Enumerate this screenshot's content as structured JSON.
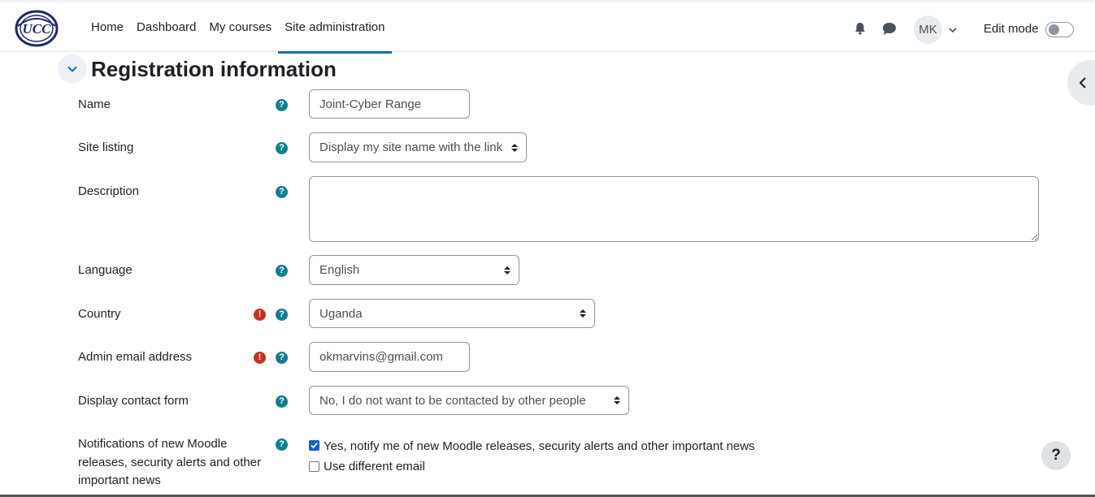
{
  "header": {
    "logo_text": "UCC",
    "nav": [
      "Home",
      "Dashboard",
      "My courses",
      "Site administration"
    ],
    "avatar_initials": "MK",
    "edit_mode_label": "Edit mode"
  },
  "section": {
    "title": "Registration information"
  },
  "form": {
    "name": {
      "label": "Name",
      "value": "Joint-Cyber Range"
    },
    "site_listing": {
      "label": "Site listing",
      "selected": "Display my site name with the link"
    },
    "description": {
      "label": "Description",
      "value": ""
    },
    "language": {
      "label": "Language",
      "selected": "English"
    },
    "country": {
      "label": "Country",
      "selected": "Uganda"
    },
    "admin_email": {
      "label": "Admin email address",
      "value": "okmarvins@gmail.com"
    },
    "contact_form": {
      "label": "Display contact form",
      "selected": "No, I do not want to be contacted by other people"
    },
    "notifications": {
      "label": "Notifications of new Moodle releases, security alerts and other important news",
      "option_notify": "Yes, notify me of new Moodle releases, security alerts and other important news",
      "option_notify_checked": true,
      "option_diff_email": "Use different email",
      "option_diff_email_checked": false
    }
  },
  "help_button_label": "?"
}
